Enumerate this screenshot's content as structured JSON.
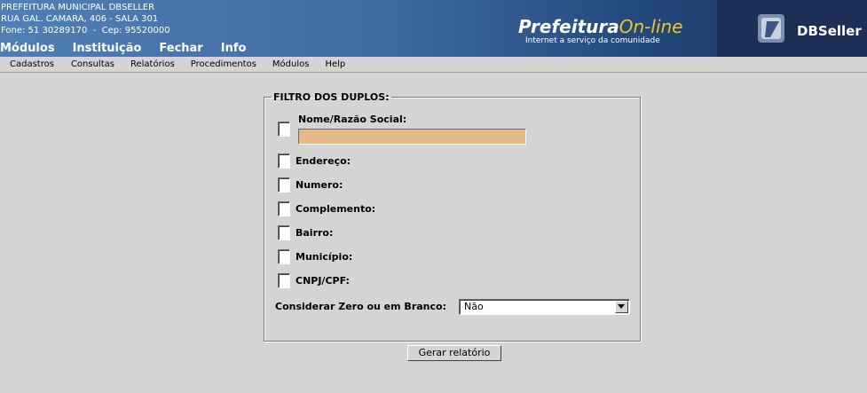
{
  "header": {
    "org_name": "PREFEITURA MUNICIPAL DBSELLER",
    "org_address": "RUA GAL. CAMARA, 406 - SALA 301",
    "org_contact": "Fone: 51 30289170  -  Cep: 95520000",
    "top_menu": [
      "Módulos",
      "Instituição",
      "Fechar",
      "Info"
    ],
    "logo_prefeitura": "Prefeitura",
    "logo_online": "On-line",
    "logo_tagline": "Internet a serviço da comunidade",
    "logo_dbseller": "DBSeller"
  },
  "menubar": [
    "Cadastros",
    "Consultas",
    "Relatórios",
    "Procedimentos",
    "Módulos",
    "Help"
  ],
  "filter": {
    "legend": "FILTRO DOS DUPLOS:",
    "nome_label": "Nome/Razão Social:",
    "nome_value": "",
    "options": [
      "Endereço:",
      "Numero:",
      "Complemento:",
      "Bairro:",
      "Município:",
      "CNPJ/CPF:"
    ],
    "zero_label": "Considerar Zero ou em Branco:",
    "zero_value": "Não"
  },
  "button_gerar": "Gerar relatório",
  "colors": {
    "nome_input_bg": "#e6b98b",
    "header_blue": "#4f7fb4",
    "logo_yellow": "#f2c230"
  }
}
